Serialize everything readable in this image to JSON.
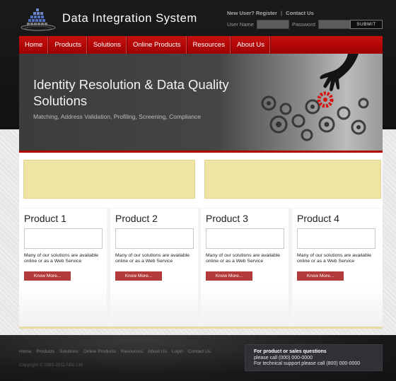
{
  "site": {
    "title": "Data Integration System"
  },
  "user_bar": {
    "new_user": "New User?",
    "register": "Register",
    "separator": "|",
    "contact": "Contact Us",
    "username_label": "User Name",
    "password_label": "Password",
    "submit_label": "SUBMIT"
  },
  "nav": {
    "items": [
      "Home",
      "Products",
      "Solutions",
      "Online Products",
      "Resources",
      "About Us"
    ]
  },
  "hero": {
    "title": "Identity Resolution & Data Quality Solutions",
    "subtitle": "Matching, Address Validation, Profiling, Screening, Compliance"
  },
  "products": [
    {
      "title": "Product 1",
      "description": "Many of our solutions are available online or as a Web Service",
      "button": "Know More..."
    },
    {
      "title": "Product 2",
      "description": "Many of our solutions are available online or as a Web Service",
      "button": "Know More..."
    },
    {
      "title": "Product 3",
      "description": "Many of our solutions are available online or as a Web Service",
      "button": "Know More..."
    },
    {
      "title": "Product 4",
      "description": "Many of our solutions are available online or as a Web Service",
      "button": "Know More..."
    }
  ],
  "footer": {
    "links": [
      "Home",
      "Products",
      "Solutions",
      "Online Products",
      "Resources",
      "About Us",
      "Login",
      "Contact Us"
    ],
    "copyright": "Copyright © 1993-2011 ABC Ltd",
    "contact_title": "For product or sales questions",
    "contact_line1": "please call (000) 000-0000",
    "contact_line2": "For technical support please call (800) 000-0000"
  },
  "colors": {
    "accent": "#b20000",
    "banner": "#f0e4a4",
    "button": "#b23a3a"
  }
}
